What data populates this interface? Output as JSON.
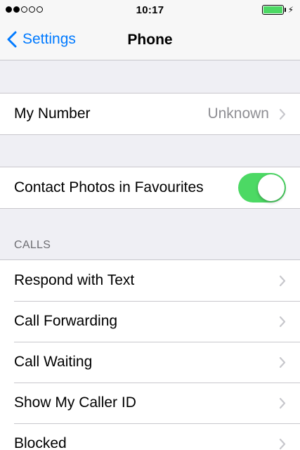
{
  "status_bar": {
    "time": "10:17",
    "signal_dots": [
      true,
      true,
      false,
      false,
      false
    ],
    "battery_color": "#4cd964",
    "battery_icon": "battery-full-icon",
    "charging_icon": "charging-bolt-icon",
    "charging_glyph": "⚡"
  },
  "nav": {
    "back_label": "Settings",
    "title": "Phone",
    "accent_color": "#007aff"
  },
  "groups": {
    "number": {
      "label": "My Number",
      "value": "Unknown"
    },
    "contacts": {
      "label": "Contact Photos in Favourites",
      "toggle_on": true,
      "toggle_color": "#4cd964"
    },
    "calls": {
      "header": "CALLS",
      "items": [
        {
          "label": "Respond with Text"
        },
        {
          "label": "Call Forwarding"
        },
        {
          "label": "Call Waiting"
        },
        {
          "label": "Show My Caller ID"
        },
        {
          "label": "Blocked"
        }
      ]
    }
  }
}
